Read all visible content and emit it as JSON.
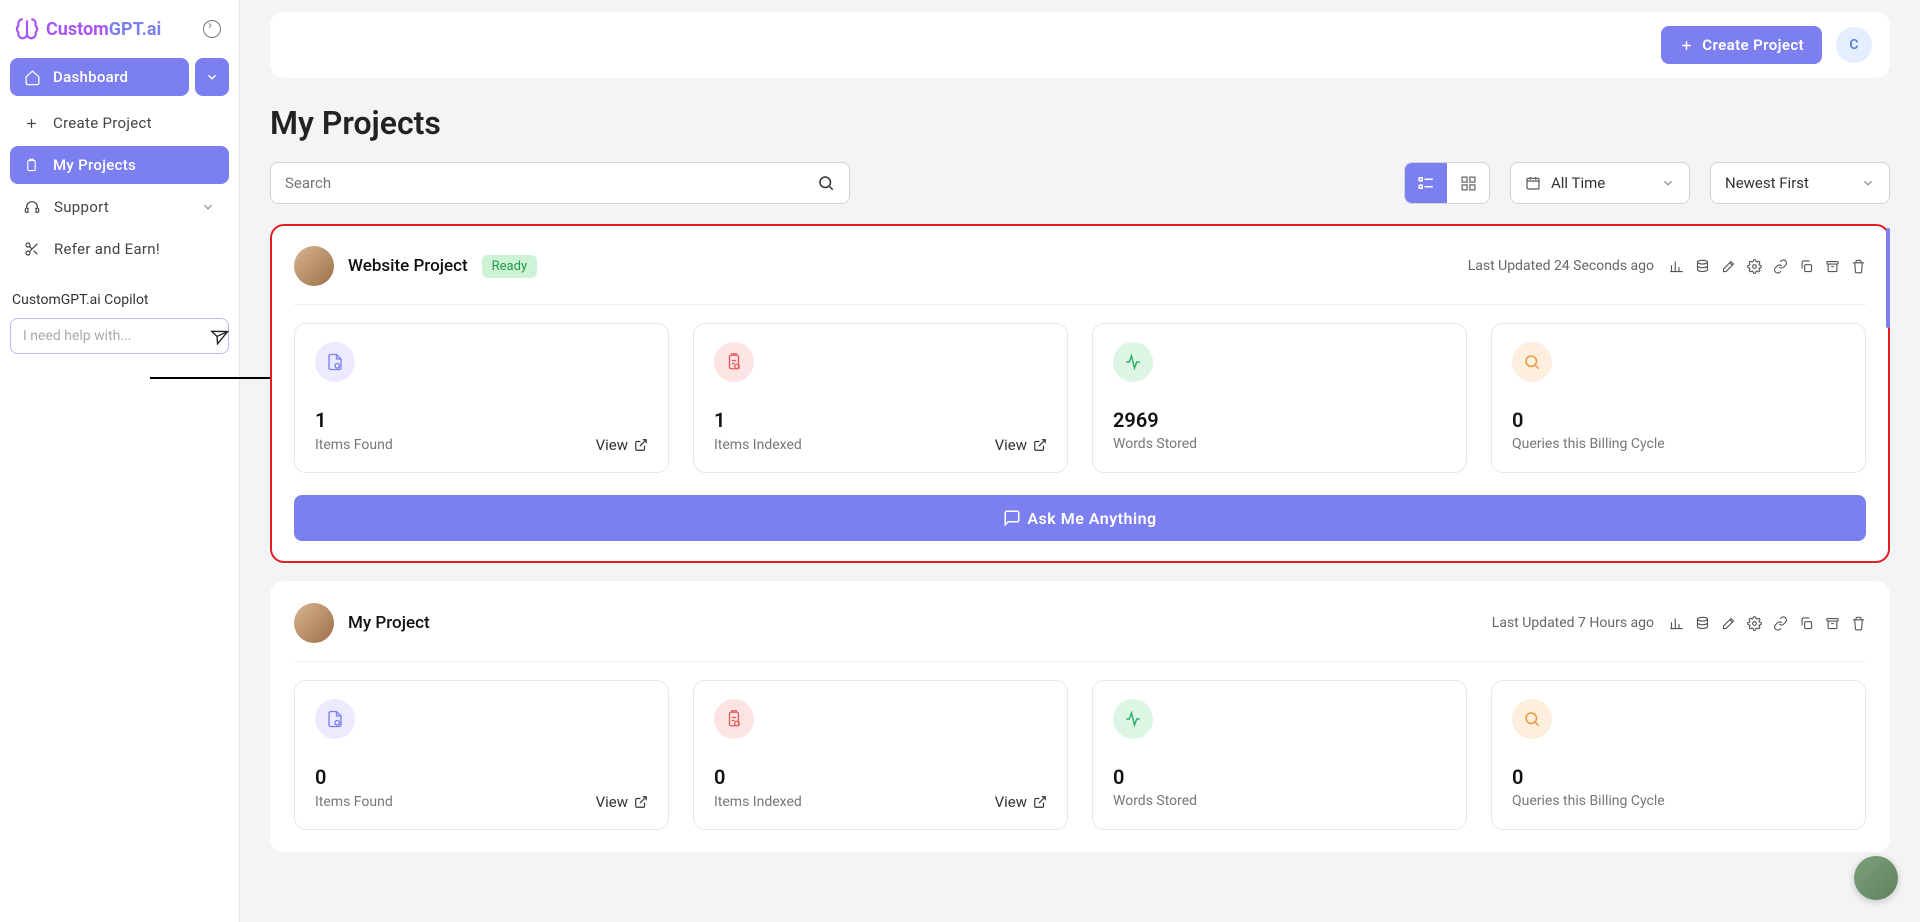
{
  "brand": {
    "name1": "Custom",
    "name2": "GPT",
    "suffix": ".ai"
  },
  "sidebar": {
    "dashboard": "Dashboard",
    "create": "Create Project",
    "myprojects": "My Projects",
    "support": "Support",
    "refer": "Refer and Earn!"
  },
  "copilot": {
    "title": "CustomGPT.ai Copilot",
    "placeholder": "I need help with..."
  },
  "topbar": {
    "create": "Create Project",
    "avatar": "C"
  },
  "page": {
    "title": "My Projects"
  },
  "controls": {
    "search_placeholder": "Search",
    "time": "All Time",
    "sort": "Newest First"
  },
  "labels": {
    "view": "View",
    "items_found": "Items Found",
    "items_indexed": "Items Indexed",
    "words_stored": "Words Stored",
    "queries": "Queries this Billing Cycle",
    "ask": "Ask Me Anything",
    "updated_prefix": "Last Updated "
  },
  "projects": [
    {
      "name": "Website Project",
      "status": "Ready",
      "updated": "24 Seconds ago",
      "items_found": "1",
      "items_indexed": "1",
      "words_stored": "2969",
      "queries": "0",
      "highlight": true,
      "show_ask": true,
      "show_badge": true
    },
    {
      "name": "My Project",
      "status": "",
      "updated": "7 Hours ago",
      "items_found": "0",
      "items_indexed": "0",
      "words_stored": "0",
      "queries": "0",
      "highlight": false,
      "show_ask": false,
      "show_badge": false
    }
  ]
}
